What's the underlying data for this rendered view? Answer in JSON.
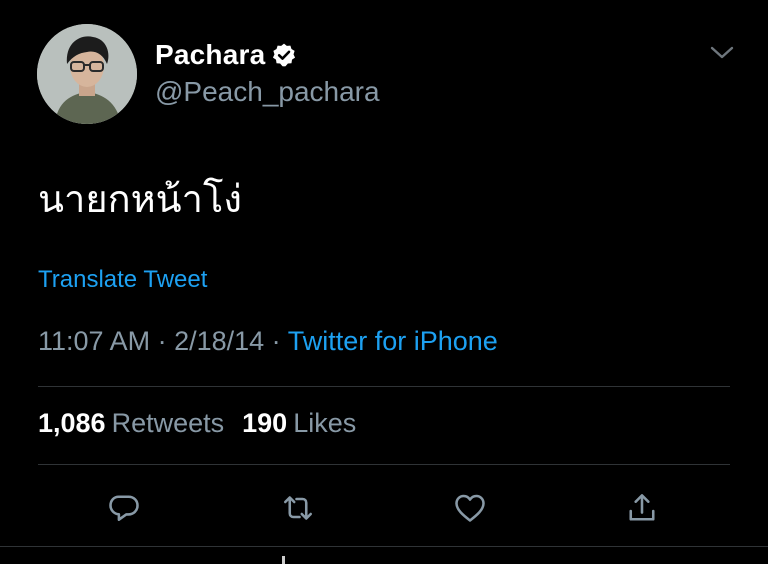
{
  "tweet": {
    "display_name": "Pachara",
    "handle": "@Peach_pachara",
    "verified": true,
    "text": "นายกหน้าโง่",
    "translate_label": "Translate Tweet",
    "time": "11:07 AM",
    "date": "2/18/14",
    "separator": " · ",
    "source": "Twitter for iPhone",
    "retweets_count": "1,086",
    "retweets_label": "Retweets",
    "likes_count": "190",
    "likes_label": "Likes"
  },
  "icons": {
    "verified": "verified-badge-icon",
    "caret": "chevron-down-icon",
    "reply": "reply-icon",
    "retweet": "retweet-icon",
    "like": "heart-icon",
    "share": "share-icon"
  },
  "colors": {
    "background": "#000000",
    "text_primary": "#ffffff",
    "text_secondary": "#8899a6",
    "accent": "#1da1f2",
    "divider": "#2f3336"
  }
}
